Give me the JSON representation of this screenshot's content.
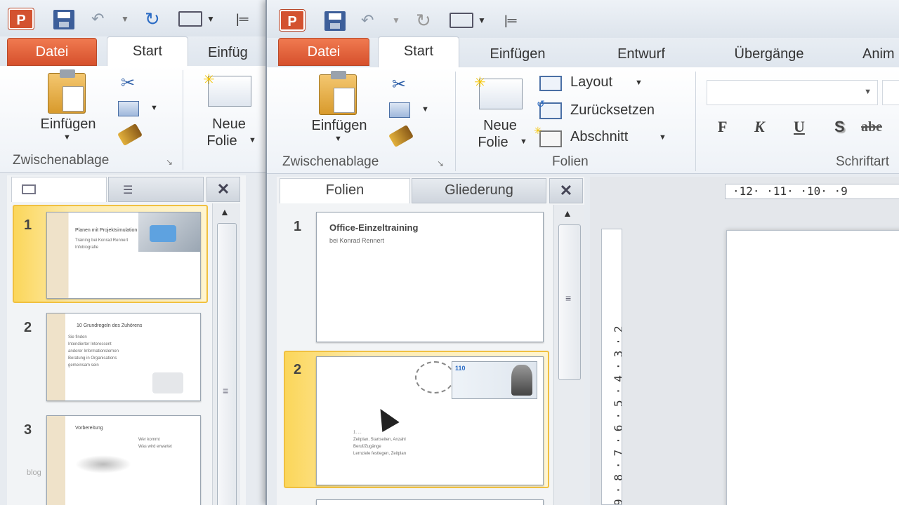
{
  "back_window": {
    "qat": {
      "undo_icon": "undo-icon",
      "redo_icon": "redo-icon"
    },
    "tabs": [
      "Datei",
      "Start",
      "Einfüg"
    ],
    "ribbon": {
      "paste_label": "Einfügen",
      "clipboard_group": "Zwischenablage",
      "new_slide_line1": "Neue",
      "new_slide_line2": "Folie"
    },
    "slides": [
      {
        "number": "1",
        "title": "Planen mit Projektsimulation",
        "lines": [
          "Training bei Konrad Rennert",
          "Infobiografie"
        ]
      },
      {
        "number": "2",
        "title": "10 Grundregeln des Zuhörens",
        "lines": [
          "Sie finden",
          "Intendierter Interessent",
          "anderer Informationslernen",
          "Beratung in Organisations",
          "gemeinsam sein"
        ]
      },
      {
        "number": "3",
        "title": "Vorbereitung",
        "lines": [
          "Wer kommt",
          "Was wird erwartet"
        ]
      }
    ],
    "watermark": "blog"
  },
  "front_window": {
    "tabs": [
      "Datei",
      "Start",
      "Einfügen",
      "Entwurf",
      "Übergänge",
      "Anim"
    ],
    "ribbon": {
      "paste_label": "Einfügen",
      "clipboard_group": "Zwischenablage",
      "new_slide_line1": "Neue",
      "new_slide_line2": "Folie",
      "layout_label": "Layout",
      "reset_label": "Zurücksetzen",
      "section_label": "Abschnitt",
      "slides_group": "Folien",
      "font_group": "Schriftart",
      "bold": "F",
      "italic": "K",
      "underline": "U",
      "shadow": "S",
      "strike": "abe"
    },
    "panel_tabs": {
      "slides": "Folien",
      "outline": "Gliederung"
    },
    "slides": [
      {
        "number": "1",
        "title": "Office-Einzeltraining",
        "subtitle": "bei Konrad Rennert"
      },
      {
        "number": "2",
        "lines": [
          "1. ...",
          "Zeitplan, Startseiten, Anzahl",
          "Beruf/Zugänge",
          "Lernziele festlegen, Zeitplan"
        ]
      }
    ],
    "h_ruler": "·12· ·11· ·10· ·9",
    "v_ruler": "9·8·7·6·5·4·3·2"
  }
}
